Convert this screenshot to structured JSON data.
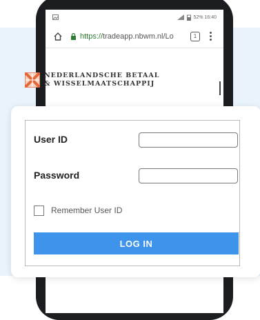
{
  "statusbar": {
    "left_icon": "image-icon",
    "right_text": "52% 16:40"
  },
  "browser": {
    "url_scheme": "https://",
    "url_rest": "tradeapp.nbwm.nl/Lo",
    "tabs_count": "1"
  },
  "brand": {
    "line1": "NEDERLANDSCHE BETAAL",
    "line2": "& WISSELMAATSCHAPPIJ",
    "logo_color": "#e2683b"
  },
  "login_form": {
    "user_id_label": "User ID",
    "user_id_value": "",
    "password_label": "Password",
    "password_value": "",
    "remember_label": "Remember User ID",
    "remember_checked": false,
    "login_button": "LOG IN"
  },
  "colors": {
    "accent": "#3d94ea",
    "background_band": "#eaf3fb",
    "phone_body": "#1c1d20"
  }
}
